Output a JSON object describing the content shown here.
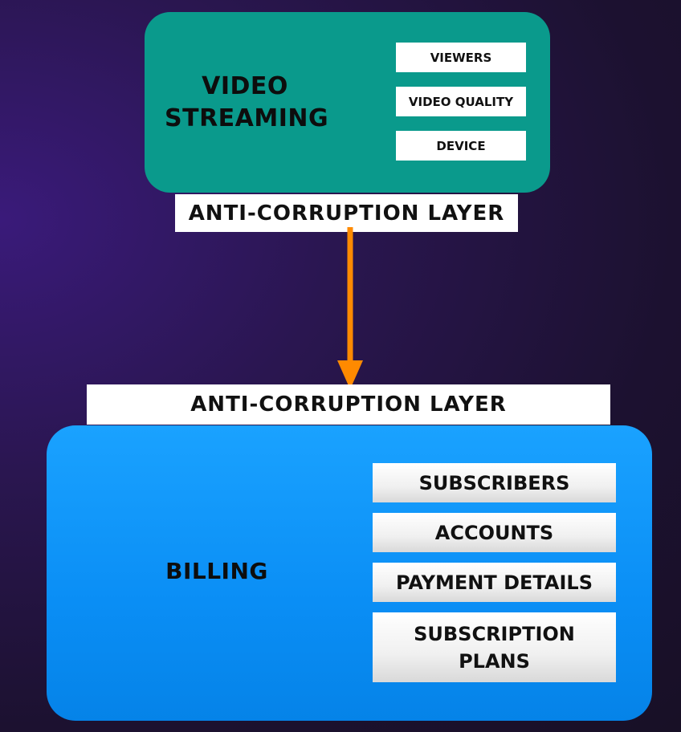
{
  "video_streaming": {
    "title_line1": "VIDEO",
    "title_line2": "STREAMING",
    "items": [
      "VIEWERS",
      "VIDEO QUALITY",
      "DEVICE"
    ]
  },
  "acl_top": "ANTI-CORRUPTION LAYER",
  "acl_bottom": "ANTI-CORRUPTION LAYER",
  "billing": {
    "title": "BILLING",
    "items": [
      "SUBSCRIBERS",
      "ACCOUNTS",
      "PAYMENT DETAILS"
    ],
    "plans_line1": "SUBSCRIPTION",
    "plans_line2": "PLANS"
  },
  "colors": {
    "streaming": "#0a9a8c",
    "billing": "#0a8ef5",
    "arrow": "#ff8a00"
  }
}
